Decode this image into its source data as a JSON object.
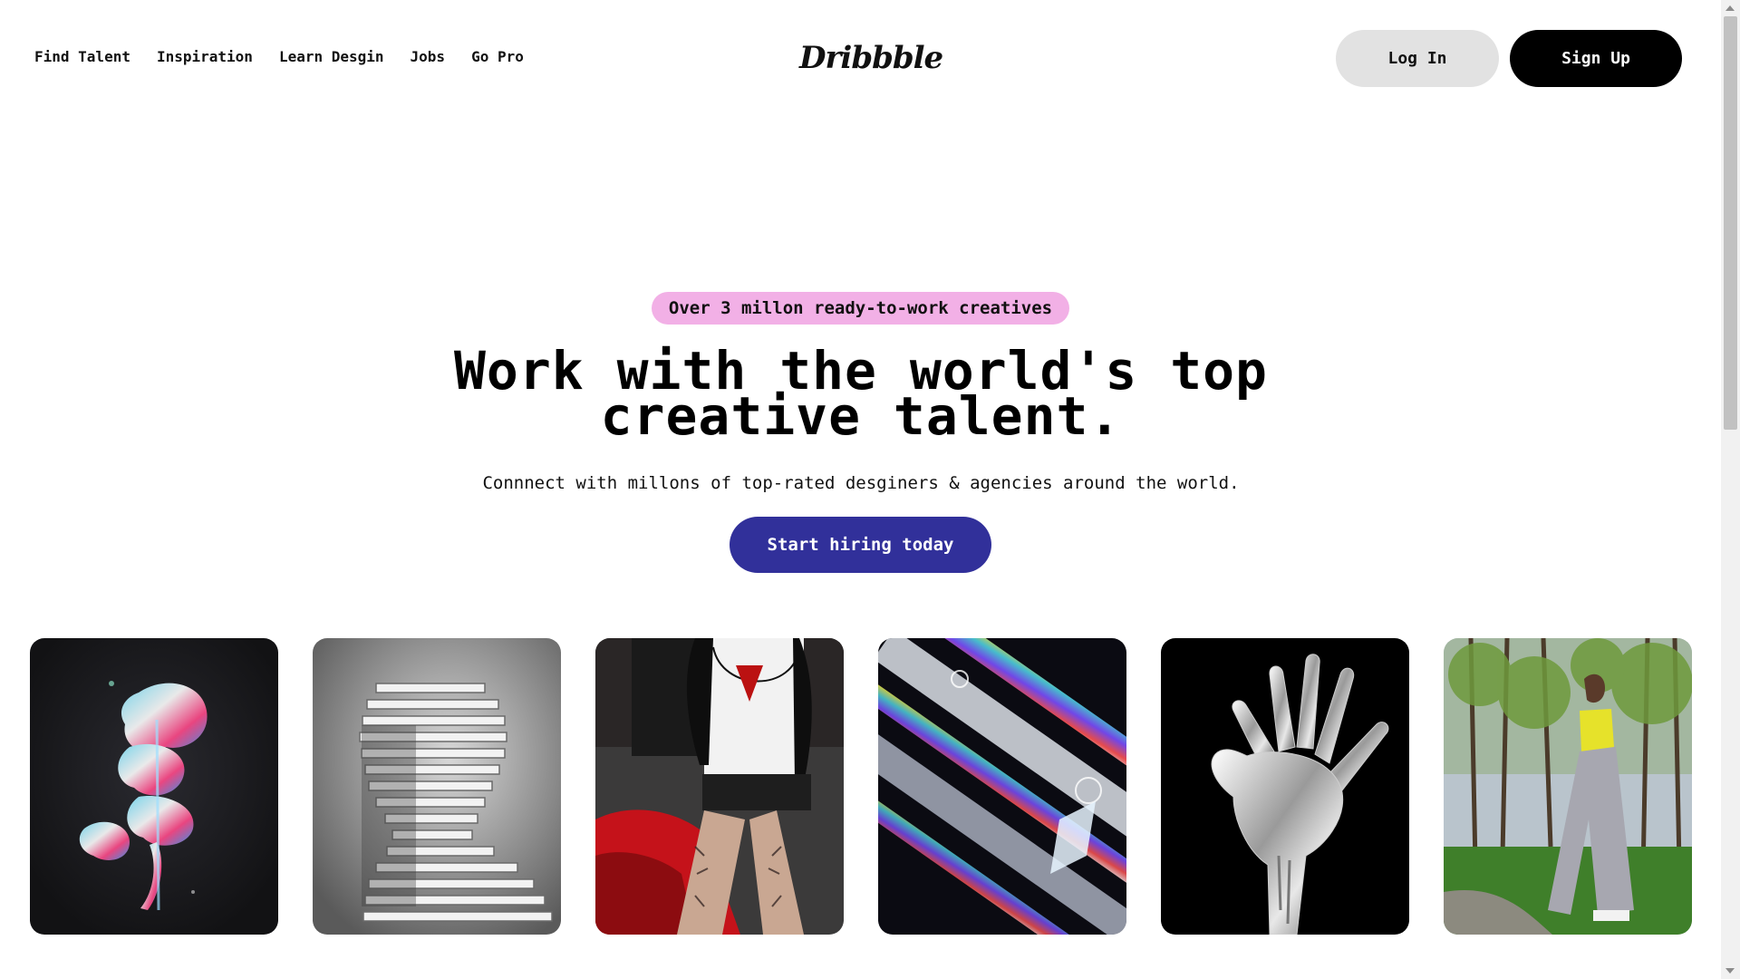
{
  "header": {
    "nav": [
      {
        "label": "Find Talent"
      },
      {
        "label": "Inspiration"
      },
      {
        "label": "Learn Desgin"
      },
      {
        "label": "Jobs"
      },
      {
        "label": "Go Pro"
      }
    ],
    "logo": "Dribbble",
    "login_label": "Log In",
    "signup_label": "Sign Up"
  },
  "hero": {
    "badge": "Over 3 millon ready-to-work creatives",
    "headline_line1": "Work with the world's top",
    "headline_line2": "creative talent.",
    "subline": "Connnect with millons of top-rated desginers & agencies around the world.",
    "cta_label": "Start hiring today"
  },
  "colors": {
    "badge_bg": "#f2b0e6",
    "cta_bg": "#31309a",
    "login_bg": "#e2e2e2",
    "signup_bg": "#000000"
  },
  "gallery": [
    {
      "subject": "iridescent-rose-image"
    },
    {
      "subject": "sliced-head-sculpture-image"
    },
    {
      "subject": "tattooed-woman-on-car-image"
    },
    {
      "subject": "prism-glass-abstract-image"
    },
    {
      "subject": "chrome-hand-image"
    },
    {
      "subject": "woman-in-forest-image"
    }
  ]
}
